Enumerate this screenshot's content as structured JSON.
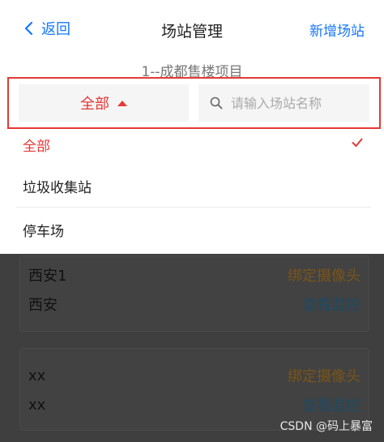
{
  "navbar": {
    "back_label": "返回",
    "title": "场站管理",
    "add_label": "新增场站"
  },
  "project": {
    "name": "1--成都售楼项目"
  },
  "filter": {
    "selected_label": "全部",
    "search_placeholder": "请输入场站名称"
  },
  "dropdown": {
    "items": [
      {
        "label": "全部",
        "selected": true
      },
      {
        "label": "垃圾收集站",
        "selected": false
      },
      {
        "label": "停车场",
        "selected": false
      }
    ]
  },
  "stations": [
    {
      "name": "西安1",
      "action": "绑定摄像头"
    },
    {
      "name": "西安",
      "action": "查看监控"
    },
    {
      "name": "xx",
      "action": "绑定摄像头"
    },
    {
      "name": "xx",
      "action": "查看监控"
    }
  ],
  "watermark": "CSDN @码上暴富",
  "colors": {
    "accent_blue": "#1677ff",
    "accent_red": "#e53935",
    "overlay": "#3f3f3f"
  }
}
